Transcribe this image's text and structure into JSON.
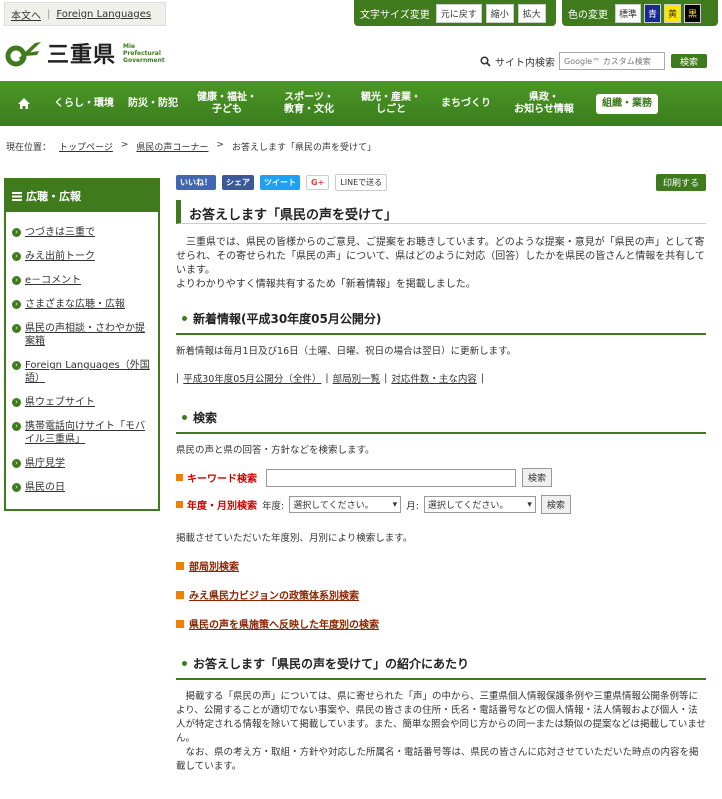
{
  "util": {
    "skip_main": "本文へ",
    "foreign": "Foreign Languages",
    "fontsize_label": "文字サイズ変更",
    "fs_reset": "元に戻す",
    "fs_small": "縮小",
    "fs_large": "拡大",
    "color_label": "色の変更",
    "c_std": "標準",
    "c_blue": "青",
    "c_yellow": "黄",
    "c_black": "黒"
  },
  "header": {
    "logo_text": "三重県",
    "logo_en": [
      "Mie",
      "Prefectural",
      "Government"
    ],
    "search_label": "サイト内検索",
    "search_placeholder": "Google™ カスタム検索",
    "search_button": "検索"
  },
  "nav": [
    {
      "label": "くらし・環境"
    },
    {
      "label": "防災・防犯"
    },
    {
      "label": "健康・福祉・\n子ども"
    },
    {
      "label": "スポーツ・\n教育・文化"
    },
    {
      "label": "観光・産業・\nしごと"
    },
    {
      "label": "まちづくり"
    },
    {
      "label": "県政・\nお知らせ情報"
    }
  ],
  "nav_org": "組織・業務",
  "breadcrumb": {
    "label": "現在位置：",
    "items": [
      "トップページ",
      "県民の声コーナー",
      "お答えします「県民の声を受けて」"
    ]
  },
  "sidebar": {
    "title": "広聴・広報",
    "items": [
      "つづきは三重で",
      "みえ出前トーク",
      "e－コメント",
      "さまざまな広聴・広報",
      "県民の声相談・さわやか提案箱",
      "Foreign Languages（外国語）",
      "県ウェブサイト",
      "携帯電話向けサイト「モバイル三重県」",
      "県庁見学",
      "県民の日"
    ]
  },
  "share": {
    "like": "いいね！",
    "share": "シェア",
    "tweet": "ツイート",
    "gplus": "G+",
    "line": "LINEで送る",
    "print": "印刷する"
  },
  "page_title": "お答えします「県民の声を受けて」",
  "intro": "三重県では、県民の皆様からのご意見、ご提案をお聴きしています。どのような提案・意見が「県民の声」として寄せられ、その寄せられた「県民の声」について、県はどのように対応（回答）したかを県民の皆さんと情報を共有しています。",
  "intro2": "よりわかりやすく情報共有するため「新着情報」を掲載しました。",
  "news": {
    "title": "新着情報(平成30年度05月公開分)",
    "desc": "新着情報は毎月1日及び16日（土曜、日曜、祝日の場合は翌日）に更新します。",
    "links": [
      "平成30年度05月公開分（全件）",
      "部局別一覧",
      "対応件数・主な内容"
    ]
  },
  "search": {
    "title": "検索",
    "desc": "県民の声と県の回答・方針などを検索します。",
    "kw_label": "キーワード検索",
    "kw_button": "検索",
    "ym_label": "年度・月別検索",
    "year_label": "年度:",
    "year_value": "選択してください。",
    "month_label": "月:",
    "month_value": "選択してください。",
    "ym_button": "検索",
    "desc2": "掲載させていただいた年度別、月別により検索します。",
    "links": [
      "部局別検索",
      "みえ県民力ビジョンの政策体系別検索",
      "県民の声を県施策へ反映した年度別の検索"
    ]
  },
  "intro_sec": {
    "title": "お答えします「県民の声を受けて」の紹介にあたり",
    "p1": "掲載する「県民の声」については、県に寄せられた「声」の中から、三重県個人情報保護条例や三重県情報公開条例等により、公開することが適切でない事案や、県民の皆さまの住所・氏名・電話番号などの個人情報・法人情報および個人・法人が特定される情報を除いて掲載しています。また、簡単な照会や同じ方からの同一または類似の提案などは掲載していません。",
    "p2": "なお、県の考え方・取組・方針や対応した所属名・電話番号等は、県民の皆さんに応対させていただいた時点の内容を掲載しています。"
  }
}
